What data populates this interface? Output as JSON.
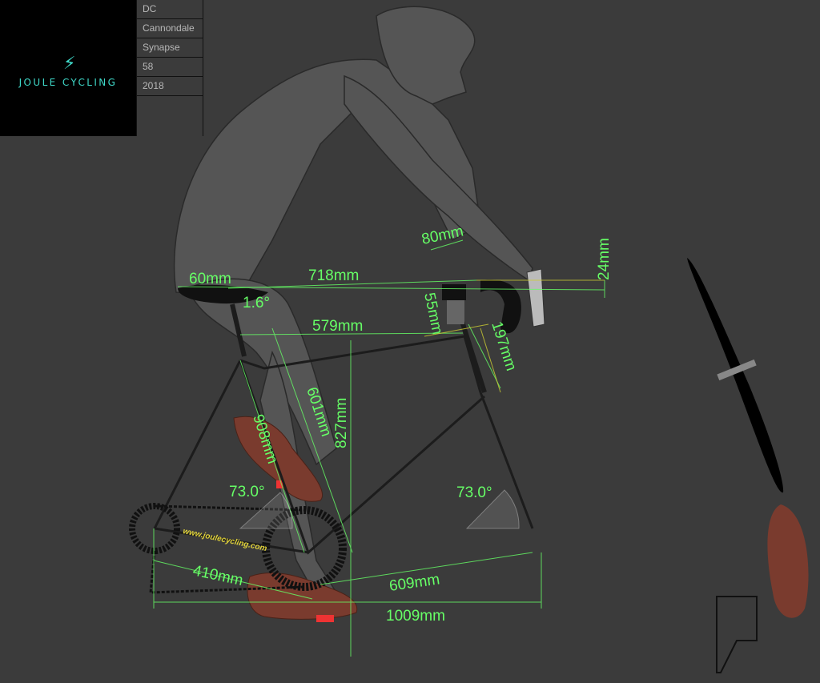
{
  "brand": {
    "name": "JOULE CYCLING",
    "watermark": "www.joulecycling.com",
    "icon": "lightning-bolt-icon",
    "accent_color": "#3fd9c9"
  },
  "bike_info": [
    "DC",
    "Cannondale",
    "Synapse",
    "58",
    "2018"
  ],
  "measurements": {
    "saddle_setback": "60mm",
    "saddle_to_bar": "718mm",
    "saddle_tilt": "1.6°",
    "bar_drop": "24mm",
    "stem_length": "80mm",
    "spacers": "55mm",
    "head_tube": "197mm",
    "top_tube": "579mm",
    "seat_tube": "601mm",
    "saddle_height": "908mm",
    "stack": "827mm",
    "seat_angle": "73.0°",
    "head_angle": "73.0°",
    "chainstay": "410mm",
    "front_center": "609mm",
    "wheelbase": "1009mm"
  },
  "colors": {
    "background": "#3b3b3b",
    "rider": "#555555",
    "frame": "#3a3a3a",
    "measure_green": "#66ff66",
    "measure_yellow": "#cccc33",
    "shoe": "#7a3b2e"
  }
}
